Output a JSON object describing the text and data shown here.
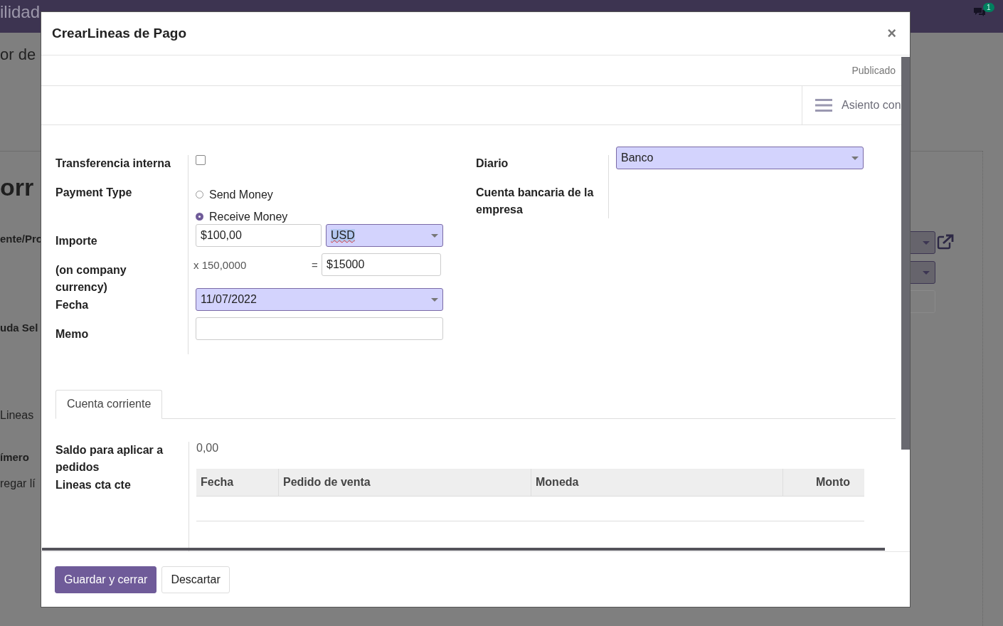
{
  "background": {
    "app_title": "ilidad",
    "chat_badge": "1",
    "texts": [
      {
        "kind": "plain",
        "text": "or de"
      },
      {
        "kind": "heading",
        "text": "orr"
      },
      {
        "kind": "label",
        "text": "ente/Pro"
      },
      {
        "kind": "label",
        "text": "uda Sel"
      },
      {
        "kind": "plain",
        "text": "Lineas"
      },
      {
        "kind": "label",
        "text": "ímero"
      },
      {
        "kind": "plain",
        "text": "regar lí"
      }
    ]
  },
  "dialog": {
    "title": "CrearLineas de Pago",
    "close": "×",
    "status": "Publicado",
    "smart_button": "Asiento con",
    "left_fields": [
      {
        "kind": "checkbox",
        "label": "Transferencia interna",
        "checked": false
      },
      {
        "kind": "radio",
        "label": "Payment Type",
        "options": [
          {
            "label": "Send Money",
            "selected": false
          },
          {
            "label": "Receive Money",
            "selected": true
          }
        ]
      },
      {
        "kind": "amount",
        "label": "Importe",
        "value": "$100,00",
        "currency": "USD"
      },
      {
        "kind": "rate",
        "label": "(on company currency)",
        "rate": "x 150,0000",
        "equals": "=",
        "value": "$15000"
      },
      {
        "kind": "select",
        "label": "Fecha",
        "value": "11/07/2022"
      },
      {
        "kind": "input",
        "label": "Memo"
      }
    ],
    "right_fields": [
      {
        "kind": "select",
        "label": "Diario",
        "value": "Banco"
      },
      {
        "kind": "empty",
        "label": "Cuenta bancaria de la empresa"
      }
    ],
    "tabs": [
      {
        "label": "Cuenta corriente",
        "selected": true
      }
    ],
    "tab_fields": [
      {
        "label": "Saldo para aplicar a pedidos",
        "value": "0,00"
      },
      {
        "label": "Lineas cta cte"
      }
    ],
    "table": {
      "columns": [
        {
          "label": "Fecha"
        },
        {
          "label": "Pedido de venta"
        },
        {
          "label": "Moneda"
        },
        {
          "label": "Monto"
        }
      ]
    },
    "buttons": [
      {
        "label": "Guardar y cerrar",
        "kind": "primary"
      },
      {
        "label": "Descartar",
        "kind": "secondary"
      }
    ]
  }
}
